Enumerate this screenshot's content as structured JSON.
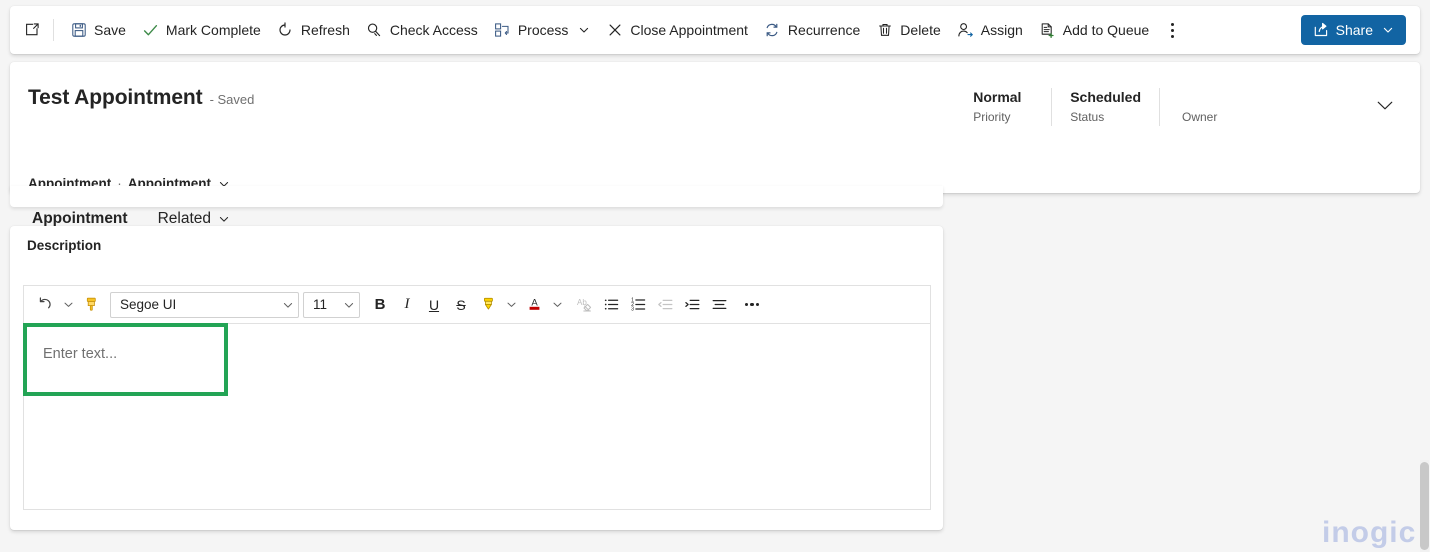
{
  "commandbar": {
    "popout_tooltip": "Open in new window",
    "buttons": [
      {
        "label": "Save",
        "icon": "save-icon"
      },
      {
        "label": "Mark Complete",
        "icon": "checkmark-icon"
      },
      {
        "label": "Refresh",
        "icon": "refresh-icon"
      },
      {
        "label": "Check Access",
        "icon": "key-icon"
      },
      {
        "label": "Process",
        "icon": "process-icon",
        "has_chevron": true
      },
      {
        "label": "Close Appointment",
        "icon": "close-x-icon"
      },
      {
        "label": "Recurrence",
        "icon": "recurrence-icon"
      },
      {
        "label": "Delete",
        "icon": "trash-icon"
      },
      {
        "label": "Assign",
        "icon": "assign-person-icon"
      },
      {
        "label": "Add to Queue",
        "icon": "add-to-queue-icon"
      }
    ],
    "overflow_label": "More commands",
    "share": {
      "label": "Share",
      "icon": "share-icon",
      "color": "#1264a3"
    }
  },
  "header": {
    "title": "Test Appointment",
    "saved_state": "- Saved",
    "breadcrumb_entity": "Appointment",
    "breadcrumb_form": "Appointment",
    "breadcrumb_separator": "·",
    "tabs": [
      {
        "label": "Appointment",
        "active": true,
        "has_chevron": false
      },
      {
        "label": "Related",
        "active": false,
        "has_chevron": true
      }
    ],
    "active_tab_color": "#1264a3",
    "meta": [
      {
        "value": "Normal",
        "label": "Priority"
      },
      {
        "value": "Scheduled",
        "label": "Status"
      },
      {
        "value": "",
        "label": "Owner"
      }
    ],
    "expand_tooltip": "Show more"
  },
  "description": {
    "label": "Description",
    "editor": {
      "undo_icon": "undo-icon",
      "format_painter_icon": "format-painter-icon",
      "font_family": "Segoe UI",
      "font_size": "11",
      "bold": "B",
      "italic": "I",
      "underline": "U",
      "strikethrough": "S",
      "highlight_icon": "highlighter-icon",
      "font_color_icon": "font-color-icon",
      "clear_format_icon": "clear-formatting-icon",
      "bulleted_list_icon": "bulleted-list-icon",
      "numbered_list_icon": "numbered-list-icon",
      "decrease_indent_icon": "decrease-indent-icon",
      "increase_indent_icon": "increase-indent-icon",
      "align_icon": "align-icon",
      "more_icon": "more-options-icon",
      "highlight_color": "#ffd400",
      "font_color": "#c00000",
      "placeholder": "Enter text..."
    },
    "highlight_annotation_color": "#23a455"
  },
  "watermark": {
    "text": "inogic",
    "color": "#c3cce8"
  }
}
